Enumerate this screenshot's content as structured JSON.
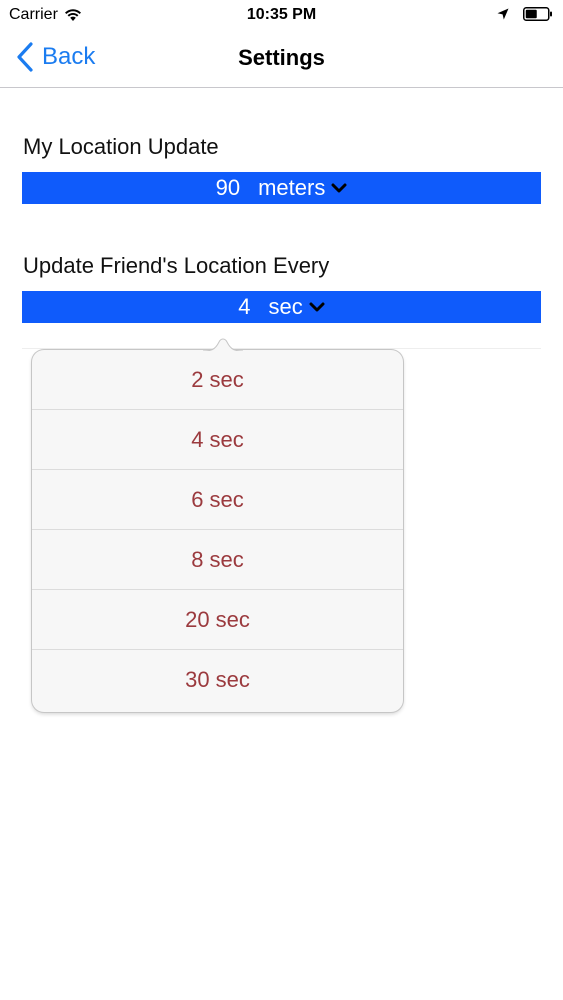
{
  "status_bar": {
    "carrier": "Carrier",
    "time": "10:35 PM"
  },
  "nav": {
    "back_label": "Back",
    "title": "Settings"
  },
  "settings": {
    "location_update": {
      "label": "My Location Update",
      "value": "90",
      "unit": "meters"
    },
    "friend_update": {
      "label": "Update Friend's Location Every",
      "value": "4",
      "unit": "sec"
    }
  },
  "dropdown": {
    "options": [
      "2 sec",
      "4 sec",
      "6 sec",
      "8 sec",
      "20 sec",
      "30 sec"
    ]
  },
  "colors": {
    "accent": "#1b7cf0",
    "picker_bg": "#0f5bfb",
    "option_text": "#9b3a3e"
  }
}
